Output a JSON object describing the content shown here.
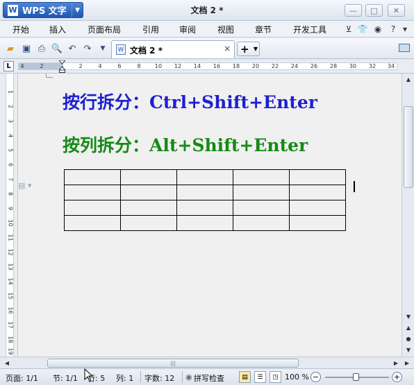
{
  "app": {
    "name": "WPS 文字",
    "logo_letter": "W",
    "document_title": "文档 2 *"
  },
  "menu": {
    "items": [
      "开始",
      "插入",
      "页面布局",
      "引用",
      "审阅",
      "视图",
      "章节",
      "开发工具"
    ]
  },
  "toolbar": {
    "tab_label": "文档 2 *",
    "tab_close": "×",
    "new_tab": "+"
  },
  "ruler": {
    "corner": "L",
    "numbers": [
      "4",
      "2",
      "2",
      "4",
      "6",
      "8",
      "10",
      "12",
      "14",
      "16",
      "18",
      "20",
      "22",
      "24",
      "26",
      "28",
      "30",
      "32",
      "34"
    ],
    "vertical_numbers": [
      "1",
      "2",
      "3",
      "4",
      "5",
      "6",
      "7",
      "8",
      "9",
      "10",
      "11",
      "12",
      "13",
      "14",
      "15",
      "16",
      "17",
      "18",
      "19"
    ]
  },
  "document": {
    "line1": "按行拆分：Ctrl+Shift+Enter",
    "line2": "按列拆分：Alt+Shift+Enter",
    "line1_color": "#1f1fd0",
    "line2_color": "#158a15",
    "table": {
      "rows": 4,
      "cols": 5
    }
  },
  "status": {
    "page": "页面: 1/1",
    "section": "节: 1/1",
    "row": "行: 5",
    "col": "列: 1",
    "words": "字数: 12",
    "spellcheck": "拼写检查",
    "zoom": "100 %"
  }
}
